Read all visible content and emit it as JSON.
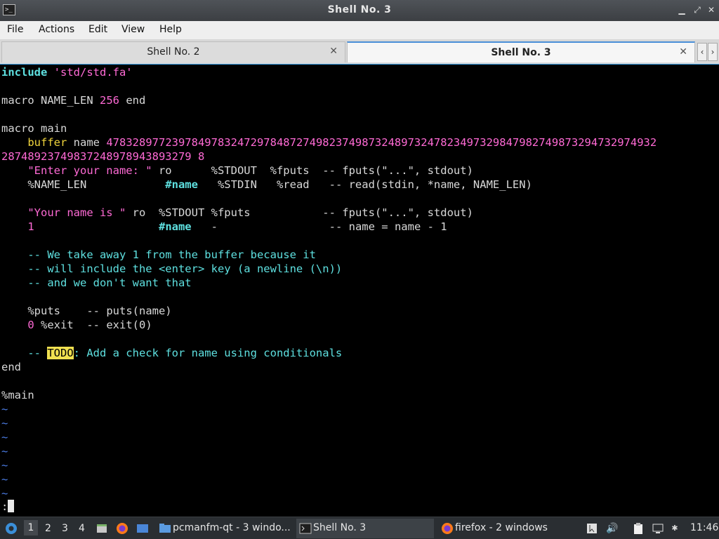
{
  "window": {
    "title": "Shell No. 3"
  },
  "menu": [
    "File",
    "Actions",
    "Edit",
    "View",
    "Help"
  ],
  "tabs": [
    {
      "label": "Shell No. 2"
    },
    {
      "label": "Shell No. 3"
    }
  ],
  "terminal": {
    "l1a": "include",
    "l1b": " 'std/std.fa'",
    "l3a": "macro NAME_LEN ",
    "l3b": "256",
    "l3c": " end",
    "l5": "macro main",
    "l6a": "    buffer",
    "l6b": " name ",
    "l6c": "478328977239784978324729784872749823749873248973247823497329847982749873294732974932",
    "l7": "28748923749837248978943893279 8",
    "l8a": "    \"Enter your name: \"",
    "l8b": " ro      %STDOUT  %fputs  ",
    "l8c": "-- fputs(\"...\", stdout)",
    "l9a": "    %NAME_LEN            ",
    "l9b": "#name",
    "l9c": "   %STDIN   %read   ",
    "l9d": "-- read(stdin, *name, NAME_LEN)",
    "l11a": "    \"Your name is \"",
    "l11b": " ro  %STDOUT %fputs           ",
    "l11c": "-- fputs(\"...\", stdout)",
    "l12a": "    1",
    "l12b": "                   ",
    "l12c": "#name",
    "l12d": "   -                 ",
    "l12e": "-- name = name - 1",
    "l14": "    -- We take away 1 from the buffer because it",
    "l15": "    -- will include the <enter> key (a newline (\\n))",
    "l16": "    -- and we don't want that",
    "l18a": "    %puts    ",
    "l18b": "-- puts(name)",
    "l19a": "    0",
    "l19b": " %exit  ",
    "l19c": "-- exit(0)",
    "l21a": "    -- ",
    "l21b": "TODO",
    "l21c": ": Add a check for name using conditionals",
    "l22": "end",
    "l24": "%main",
    "tilde": "~",
    "prompt": ":"
  },
  "taskbar": {
    "desktops": [
      "1",
      "2",
      "3",
      "4"
    ],
    "tasks": [
      {
        "label": "pcmanfm-qt - 3 windo..."
      },
      {
        "label": "Shell No. 3"
      },
      {
        "label": "firefox - 2 windows"
      }
    ],
    "clock": "11:46"
  },
  "colors": {
    "accent": "#3aa0e8",
    "keyword": "#f0d43c",
    "string": "#ff6ad5",
    "comment": "#5ee0e0"
  }
}
